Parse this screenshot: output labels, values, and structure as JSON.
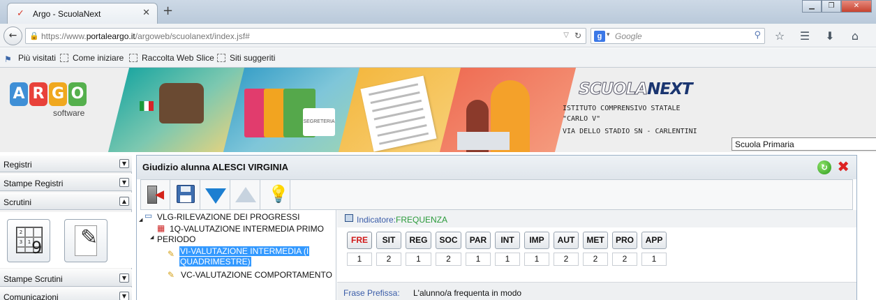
{
  "browser": {
    "tab_title": "Argo - ScuolaNext",
    "url_prefix": "https://www.",
    "url_domain": "portaleargo.it",
    "url_path": "/argoweb/scuolanext/index.jsf#",
    "search_placeholder": "Google",
    "bookmarks": [
      "Più visitati",
      "Come iniziare",
      "Raccolta Web Slice",
      "Siti suggeriti"
    ]
  },
  "banner": {
    "logo_letters": [
      "A",
      "R",
      "G",
      "O"
    ],
    "logo_colors": [
      "#3f8fd6",
      "#e8413a",
      "#f0a81f",
      "#55b04d"
    ],
    "logo_sub": "software",
    "product_a": "SCUOLA",
    "product_b": "NEXT",
    "school_line1": "ISTITUTO COMPRENSIVO STATALE",
    "school_line2": "\"CARLO V\"",
    "school_line3": "VIA DELLO STADIO SN - CARLENTINI",
    "school_type": "Scuola Primaria",
    "folder_label": "SEGRETERIA"
  },
  "left_menu": {
    "items": [
      {
        "label": "Registri",
        "state": "collapsed"
      },
      {
        "label": "Stampe Registri",
        "state": "collapsed"
      },
      {
        "label": "Scrutini",
        "state": "expanded"
      },
      {
        "label": "Stampe Scrutini",
        "state": "collapsed"
      },
      {
        "label": "Comunicazioni",
        "state": "collapsed"
      }
    ],
    "grid_digits": [
      "2",
      "",
      "",
      "3",
      "1",
      "",
      "",
      "",
      ""
    ],
    "grid_big": "9"
  },
  "panel": {
    "title": "Giudizio alunna ALESCI VIRGINIA"
  },
  "tree": {
    "root": "VLG-RILEVAZIONE DEI PROGRESSI",
    "period_line1": "1Q-VALUTAZIONE INTERMEDIA PRIMO",
    "period_line2": "PERIODO",
    "selected_line1": "VI-VALUTAZIONE INTERMEDIA (I",
    "selected_line2": "QUADRIMESTRE)",
    "other": "VC-VALUTAZIONE COMPORTAMENTO"
  },
  "indicator": {
    "label": "Indicatore:",
    "value": "FREQUENZA",
    "active_code": "FRE",
    "codes": [
      "FRE",
      "SIT",
      "REG",
      "SOC",
      "PAR",
      "INT",
      "IMP",
      "AUT",
      "MET",
      "PRO",
      "APP"
    ],
    "values": [
      "1",
      "2",
      "1",
      "2",
      "1",
      "1",
      "1",
      "2",
      "2",
      "2",
      "1"
    ]
  },
  "frase": {
    "label": "Frase Prefissa:",
    "value": "L'alunno/a frequenta in modo"
  }
}
